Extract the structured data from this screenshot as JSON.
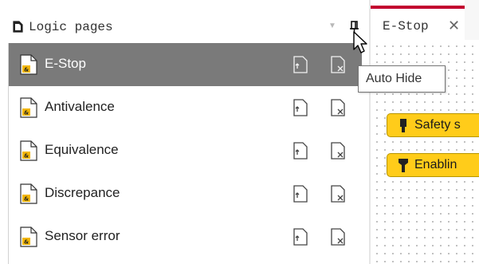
{
  "panel": {
    "title": "Logic pages",
    "title_icon": "page-icon",
    "menu_icon": "dropdown-arrow-icon",
    "pin_icon": "pin-icon",
    "items": [
      {
        "label": "E-Stop",
        "selected": true,
        "icon": "logic-page-icon",
        "actions": [
          "export-icon",
          "delete-icon"
        ]
      },
      {
        "label": "Antivalence",
        "selected": false,
        "icon": "logic-page-icon",
        "actions": [
          "export-icon",
          "delete-icon"
        ]
      },
      {
        "label": "Equivalence",
        "selected": false,
        "icon": "logic-page-icon",
        "actions": [
          "export-icon",
          "delete-icon"
        ]
      },
      {
        "label": "Discrepance",
        "selected": false,
        "icon": "logic-page-icon",
        "actions": [
          "export-icon",
          "delete-icon"
        ]
      },
      {
        "label": "Sensor error",
        "selected": false,
        "icon": "logic-page-icon",
        "actions": [
          "export-icon",
          "delete-icon"
        ]
      }
    ]
  },
  "tooltip": {
    "text": "Auto Hide"
  },
  "editor": {
    "tab": {
      "label": "E-Stop",
      "close_glyph": "✕",
      "accent_color": "#c2002f"
    },
    "blocks": [
      {
        "label": "Safety s",
        "color": "#ffcc1a"
      },
      {
        "label": "Enablin",
        "color": "#ffcc1a"
      }
    ]
  },
  "colors": {
    "selected_row": "#7a7a7a",
    "page_icon_badge": "#f2b600"
  }
}
